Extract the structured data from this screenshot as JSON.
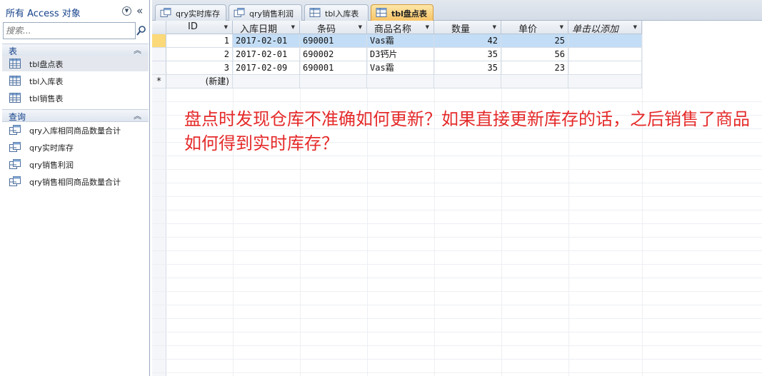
{
  "nav": {
    "title": "所有 Access 对象",
    "search_placeholder": "搜索...",
    "groups": {
      "tables": {
        "label": "表",
        "items": [
          {
            "label": "tbl盘点表"
          },
          {
            "label": "tbl入库表"
          },
          {
            "label": "tbl销售表"
          }
        ]
      },
      "queries": {
        "label": "查询",
        "items": [
          {
            "label": "qry入库相同商品数量合计"
          },
          {
            "label": "qry实时库存"
          },
          {
            "label": "qry销售利润"
          },
          {
            "label": "qry销售相同商品数量合计"
          }
        ]
      }
    }
  },
  "tabs": [
    {
      "label": "qry实时库存",
      "icon": "query-icon"
    },
    {
      "label": "qry销售利润",
      "icon": "query-icon"
    },
    {
      "label": "tbl入库表",
      "icon": "table-icon"
    },
    {
      "label": "tbl盘点表",
      "icon": "table-icon",
      "active": true
    }
  ],
  "datasheet": {
    "columns": [
      "ID",
      "入库日期",
      "条码",
      "商品名称",
      "数量",
      "单价",
      "单击以添加"
    ],
    "rows": [
      {
        "id": "1",
        "date": "2017-02-01",
        "barcode": "690001",
        "name": "Vas霜",
        "qty": "42",
        "price": "25"
      },
      {
        "id": "2",
        "date": "2017-02-01",
        "barcode": "690002",
        "name": "D3钙片",
        "qty": "35",
        "price": "56"
      },
      {
        "id": "3",
        "date": "2017-02-09",
        "barcode": "690001",
        "name": "Vas霜",
        "qty": "35",
        "price": "23"
      }
    ],
    "new_row_marker": "*",
    "new_row_label": "(新建)"
  },
  "annotation": "盘点时发现仓库不准确如何更新？如果直接更新库存的话，之后销售了商品如何得到实时库存？",
  "colors": {
    "accent_tab": "#f7c466",
    "selected_row": "#c3ddf6",
    "annotation_text": "#e52a2a",
    "nav_header_text": "#15428b"
  }
}
